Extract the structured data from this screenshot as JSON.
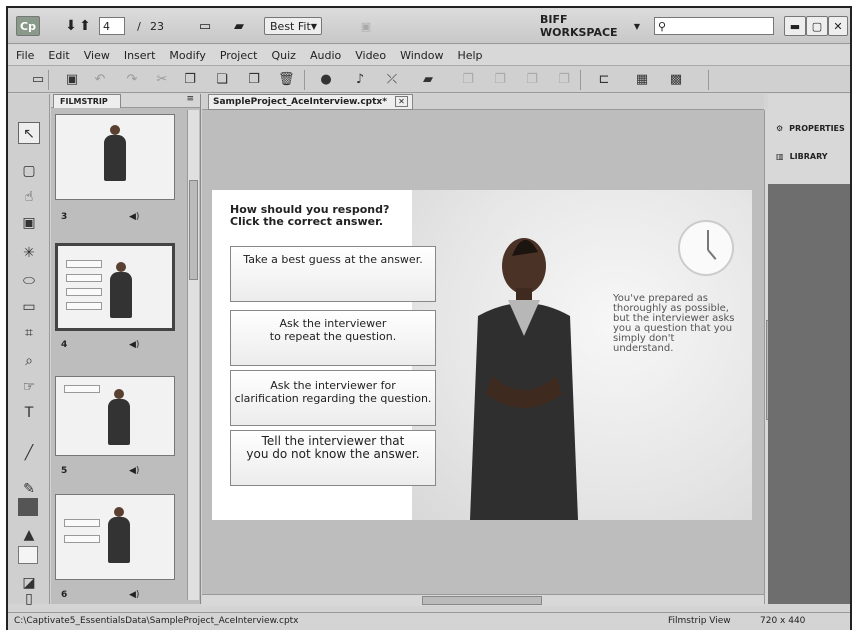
{
  "titlebar": {
    "app_icon": "Cp",
    "slide_current": "4",
    "slide_separator": "/",
    "slide_total": "23",
    "zoom": "Best Fit",
    "workspace": "BIFF WORKSPACE"
  },
  "menu": [
    "File",
    "Edit",
    "View",
    "Insert",
    "Modify",
    "Project",
    "Quiz",
    "Audio",
    "Video",
    "Window",
    "Help"
  ],
  "filmstrip": {
    "label": "FILMSTRIP",
    "slides": [
      {
        "num": "3"
      },
      {
        "num": "4"
      },
      {
        "num": "5"
      },
      {
        "num": "6"
      }
    ]
  },
  "document": {
    "tab": "SampleProject_AceInterview.cptx*"
  },
  "slide": {
    "question": [
      "How should you respond?",
      "Click the correct answer."
    ],
    "answers": [
      "Take a best guess at the answer.",
      "Ask the interviewer\nto repeat the question.",
      "Ask the interviewer for\nclarification regarding the question.",
      "Tell the interviewer that\nyou do not know the answer."
    ],
    "narration": "You've prepared as thoroughly as possible, but the interviewer asks you a question that you simply don't understand."
  },
  "rightpanel": {
    "properties": "PROPERTIES",
    "library": "LIBRARY"
  },
  "status": {
    "path": "C:\\Captivate5_EssentialsData\\SampleProject_AceInterview.cptx",
    "view": "Filmstrip View",
    "size": "720 x 440"
  }
}
